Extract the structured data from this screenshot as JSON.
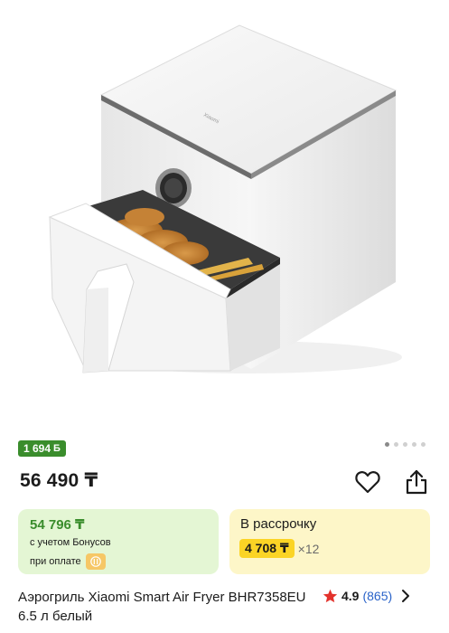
{
  "product": {
    "image_alt": "air-fryer-photo",
    "brand_mark": "Xiaomi",
    "bonus_badge": "1 694",
    "bonus_badge_icon": "Б",
    "price": "56 490 ₸",
    "title": "Аэрогриль Xiaomi Smart Air Fryer BHR7358EU 6.5 л белый",
    "rating": "4.9",
    "reviews": "(865)"
  },
  "gallery": {
    "slides": 5,
    "active_index": 0
  },
  "bonus_card": {
    "price": "54 796 ₸",
    "line1": "с учетом Бонусов",
    "line2": "при оплате"
  },
  "installment": {
    "title": "В рассрочку",
    "amount": "4 708 ₸",
    "times": "×12"
  },
  "icons": {
    "favorite": "heart-icon",
    "share": "share-icon",
    "star": "star-icon",
    "chevron": "chevron-right-icon",
    "pay": "fork-knife-icon"
  },
  "colors": {
    "bonus_green": "#3a8d2c",
    "bonus_bg": "#e4f6d4",
    "install_bg": "#fdf6c8",
    "install_accent": "#fbd425",
    "star": "#e3322c",
    "link": "#2a63c9"
  }
}
